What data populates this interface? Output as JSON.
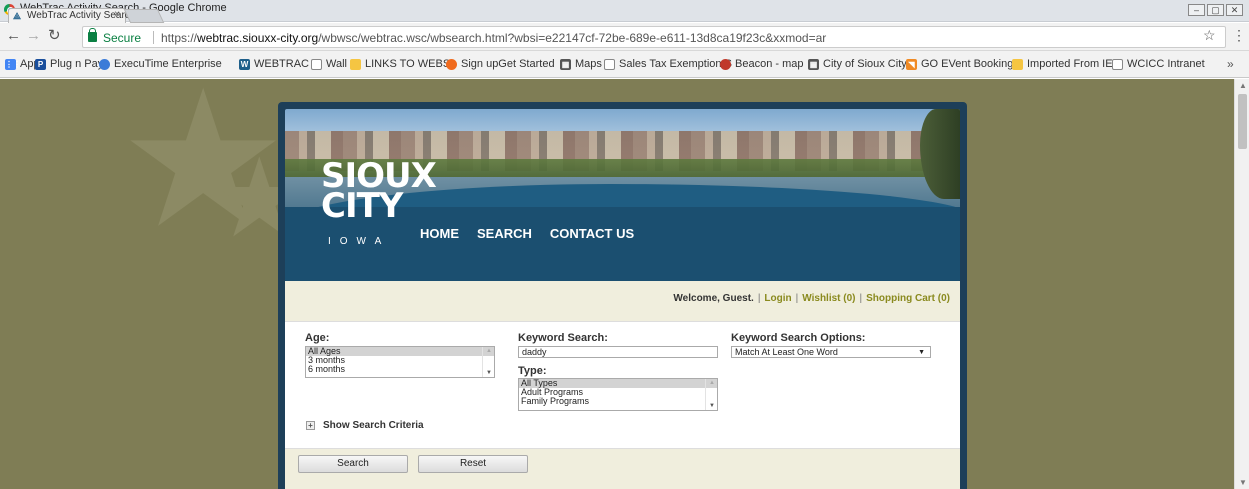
{
  "window": {
    "title": "WebTrac Activity Search - Google Chrome",
    "controls": [
      "–",
      "▢",
      "✕"
    ]
  },
  "tab": {
    "title": "WebTrac Activity Search",
    "close": "×"
  },
  "address_bar": {
    "secure_label": "Secure",
    "url_scheme": "https://",
    "url_host": "webtrac.siouxx-city.org",
    "url_path": "/wbwsc/webtrac.wsc/wbsearch.html?wbsi=e22147cf-72be-689e-e611-13d8ca19f23c&xxmod=ar"
  },
  "bookmarks": [
    {
      "label": "Apps",
      "icon": "apps-grid-icon",
      "color": "#4285f4"
    },
    {
      "label": "Plug n Pay",
      "icon": "p-logo-icon",
      "color": "#1a4f9c"
    },
    {
      "label": "ExecuTime Enterprise",
      "icon": "globe-icon",
      "color": "#3b7bd8"
    },
    {
      "label": "WEBTRAC",
      "icon": "webtrac-icon",
      "color": "#1e5f8a"
    },
    {
      "label": "Wall",
      "icon": "page-icon",
      "color": "#888888"
    },
    {
      "label": "LINKS TO WEBS",
      "icon": "folder-icon",
      "color": "#f5c542"
    },
    {
      "label": "Sign upGet Started",
      "icon": "signup-icon",
      "color": "#f06a1d"
    },
    {
      "label": "Maps",
      "icon": "maps-icon",
      "color": "#555555"
    },
    {
      "label": "Sales Tax Exemption S",
      "icon": "page-icon",
      "color": "#888888"
    },
    {
      "label": "Beacon - map",
      "icon": "beacon-icon",
      "color": "#c0392b"
    },
    {
      "label": "City of Sioux City",
      "icon": "city-icon",
      "color": "#555555"
    },
    {
      "label": "GO EVent Booking",
      "icon": "rss-icon",
      "color": "#f08a24"
    },
    {
      "label": "Imported From IE",
      "icon": "folder-icon",
      "color": "#f5c542"
    },
    {
      "label": "WCICC Intranet",
      "icon": "page-icon",
      "color": "#888888"
    }
  ],
  "bookmarks_overflow": "»",
  "site": {
    "logo_main": "SIOUX",
    "logo_city": "CITY",
    "logo_sub": "IOWA",
    "nav": [
      "HOME",
      "SEARCH",
      "CONTACT US"
    ],
    "welcome": "Welcome, Guest.",
    "login": "Login",
    "wishlist": "Wishlist (0)",
    "cart": "Shopping Cart (0)"
  },
  "search": {
    "age_label": "Age:",
    "age_options": [
      "All Ages",
      "3 months",
      "6 months"
    ],
    "keyword_label": "Keyword Search:",
    "keyword_value": "daddy",
    "type_label": "Type:",
    "type_options": [
      "All Types",
      "Adult Programs",
      "Family Programs"
    ],
    "options_label": "Keyword Search Options:",
    "options_value": "Match At Least One Word",
    "criteria_label": "Show Search Criteria",
    "search_button": "Search",
    "reset_button": "Reset"
  }
}
